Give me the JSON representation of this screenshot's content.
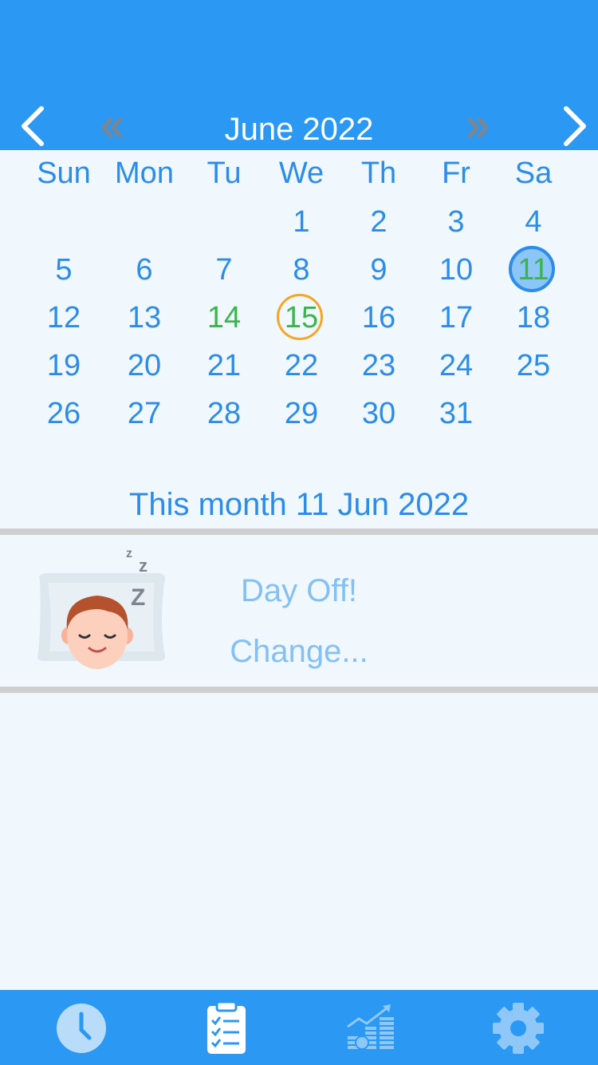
{
  "header": {
    "month_title": "June 2022",
    "prev_month_icon": "chevron-left-icon",
    "next_month_icon": "chevron-right-icon",
    "prev_year_icon": "double-chevron-left-icon",
    "next_year_icon": "double-chevron-right-icon"
  },
  "calendar": {
    "weekdays": [
      "Sun",
      "Mon",
      "Tu",
      "We",
      "Th",
      "Fr",
      "Sa"
    ],
    "weeks": [
      [
        "",
        "",
        "",
        "1",
        "2",
        "3",
        "4"
      ],
      [
        "5",
        "6",
        "7",
        "8",
        "9",
        "10",
        "11"
      ],
      [
        "12",
        "13",
        "14",
        "15",
        "16",
        "17",
        "18"
      ],
      [
        "19",
        "20",
        "21",
        "22",
        "23",
        "24",
        "25"
      ],
      [
        "26",
        "27",
        "28",
        "29",
        "30",
        "31",
        ""
      ]
    ],
    "selected_day": "11",
    "today_day": "15",
    "green_days": [
      "11",
      "14",
      "15"
    ],
    "colors": {
      "day_text": "#2b8de8",
      "green_text": "#3bb54a",
      "selected_fill": "#8cc5f7",
      "today_ring": "#f6a623"
    }
  },
  "summary": {
    "text": "This month 11 Jun 2022"
  },
  "status": {
    "icon": "sleeping-face-icon",
    "label": "Day Off!",
    "change_label": "Change..."
  },
  "tabbar": {
    "items": [
      {
        "icon": "clock-icon",
        "active": true
      },
      {
        "icon": "clipboard-checklist-icon",
        "active": false
      },
      {
        "icon": "earnings-chart-icon",
        "active": false
      },
      {
        "icon": "gear-icon",
        "active": false
      }
    ]
  },
  "colors": {
    "brand_blue": "#2b98f3",
    "background": "#f0f7fd",
    "light_blue_text": "#84c0f3",
    "divider": "#cfcfcf"
  }
}
